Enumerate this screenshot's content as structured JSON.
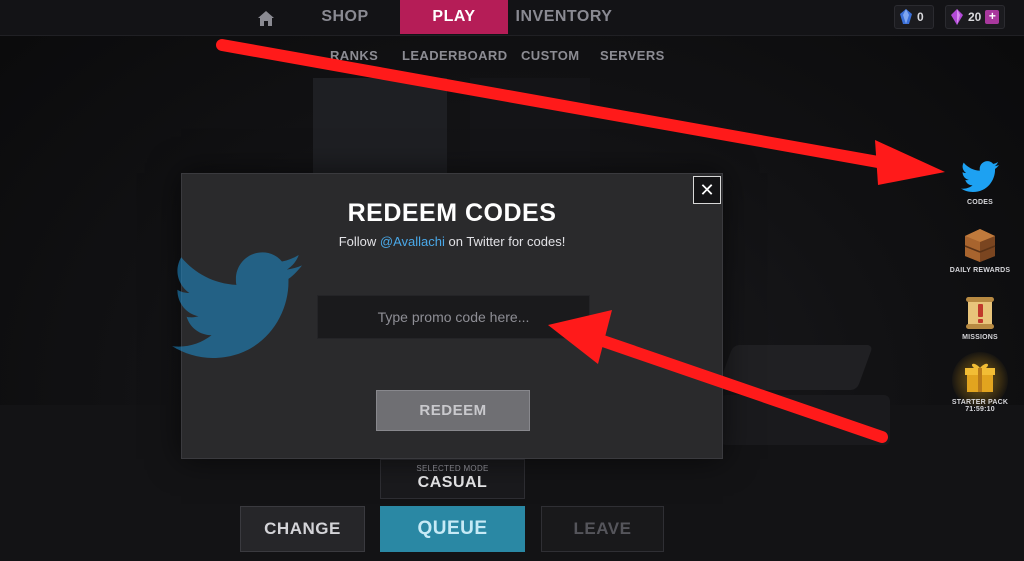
{
  "topnav": {
    "tabs": [
      {
        "label": "SHOP"
      },
      {
        "label": "PLAY"
      },
      {
        "label": "INVENTORY"
      }
    ],
    "currencies": [
      {
        "icon": "blue-crystal-icon",
        "amount": "0",
        "color": "#3a6fd8"
      },
      {
        "icon": "purple-crystal-icon",
        "amount": "20",
        "color": "#b24ad8",
        "plus": "+"
      }
    ]
  },
  "subnav": {
    "tabs": [
      {
        "label": "RANKS"
      },
      {
        "label": "LEADERBOARD"
      },
      {
        "label": "CUSTOM"
      },
      {
        "label": "SERVERS"
      }
    ]
  },
  "sidebar": {
    "items": [
      {
        "label": "CODES",
        "icon": "twitter-bird-icon"
      },
      {
        "label": "DAILY REWARDS",
        "icon": "crate-icon"
      },
      {
        "label": "MISSIONS",
        "icon": "scroll-icon"
      },
      {
        "label": "STARTER PACK",
        "icon": "gift-icon",
        "timer": "71:59:10"
      }
    ]
  },
  "modal": {
    "title": "REDEEM CODES",
    "subtitle_prefix": "Follow ",
    "subtitle_handle": "@Avallachi",
    "subtitle_suffix": " on Twitter for codes!",
    "input_placeholder": "Type promo code here...",
    "input_value": "",
    "redeem_label": "REDEEM",
    "close_label": "✕"
  },
  "mode": {
    "caption": "SELECTED MODE",
    "value": "CASUAL"
  },
  "buttons": {
    "change": "CHANGE",
    "queue": "QUEUE",
    "leave": "LEAVE"
  },
  "colors": {
    "play_tab": "#b51d57",
    "queue": "#2a88a4",
    "twitter": "#1da1f2",
    "arrow": "#ff1a1a"
  }
}
